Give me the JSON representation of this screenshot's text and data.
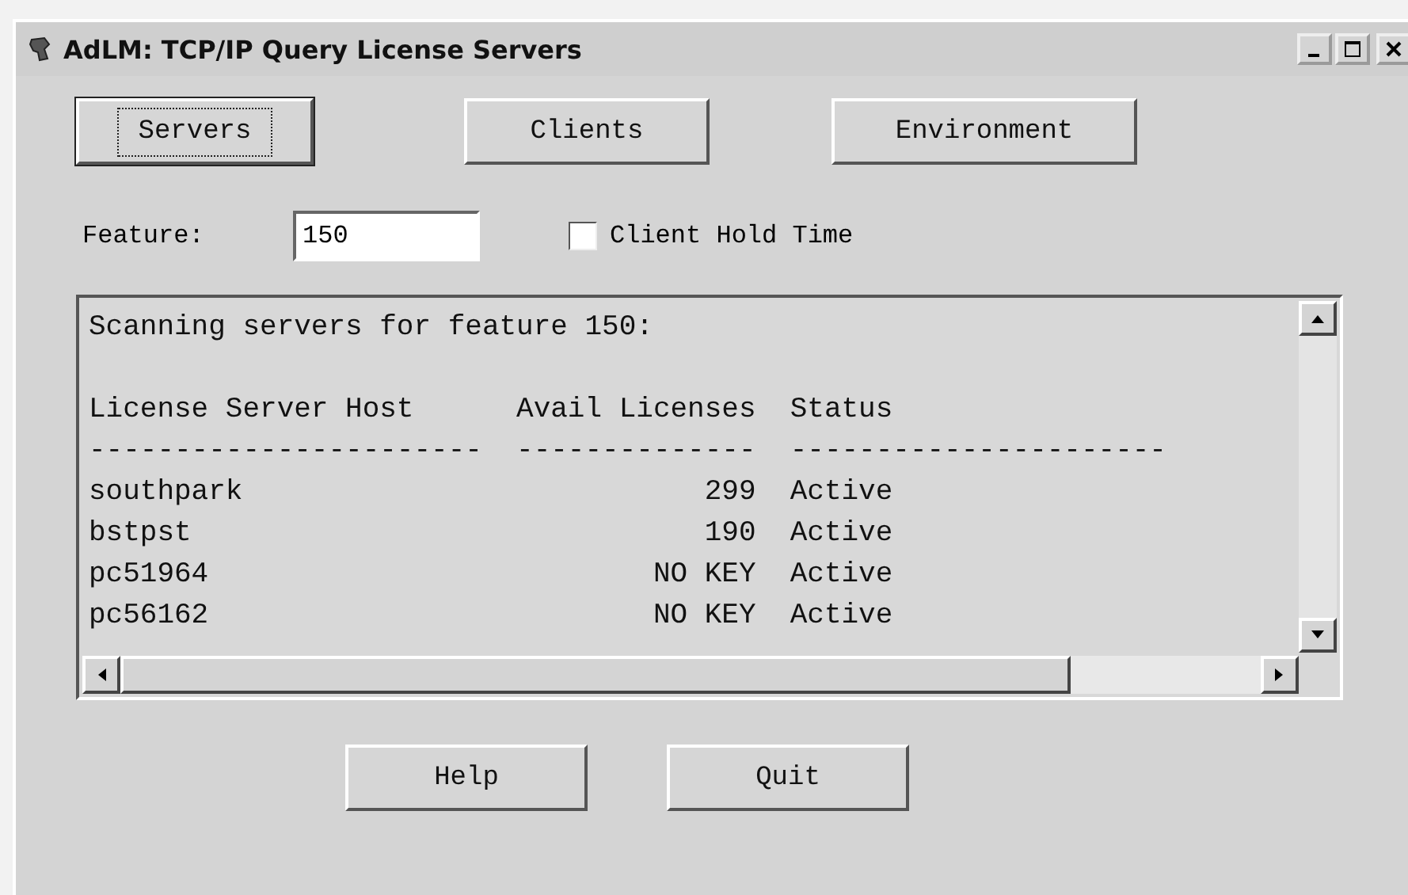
{
  "window": {
    "title": "AdLM: TCP/IP Query License Servers"
  },
  "top_buttons": [
    {
      "label": "Servers",
      "focused": true
    },
    {
      "label": "Clients",
      "focused": false
    },
    {
      "label": "Environment",
      "focused": false
    }
  ],
  "feature": {
    "label": "Feature:",
    "value": "150"
  },
  "client_hold_time": {
    "label": "Client Hold Time",
    "checked": false
  },
  "output": {
    "scan_line": "Scanning servers for feature 150:",
    "columns": [
      "License Server Host",
      "Avail Licenses",
      "Status"
    ],
    "rules": [
      "-----------------------",
      "--------------",
      "----------------------"
    ],
    "rows": [
      {
        "host": "southpark",
        "licenses": "299",
        "status": "Active"
      },
      {
        "host": "bstpst",
        "licenses": "190",
        "status": "Active"
      },
      {
        "host": "pc51964",
        "licenses": "NO KEY",
        "status": "Active"
      },
      {
        "host": "pc56162",
        "licenses": "NO KEY",
        "status": "Active"
      }
    ]
  },
  "bottom_buttons": [
    {
      "label": "Help",
      "focused": false
    },
    {
      "label": "Quit",
      "focused": false
    }
  ]
}
